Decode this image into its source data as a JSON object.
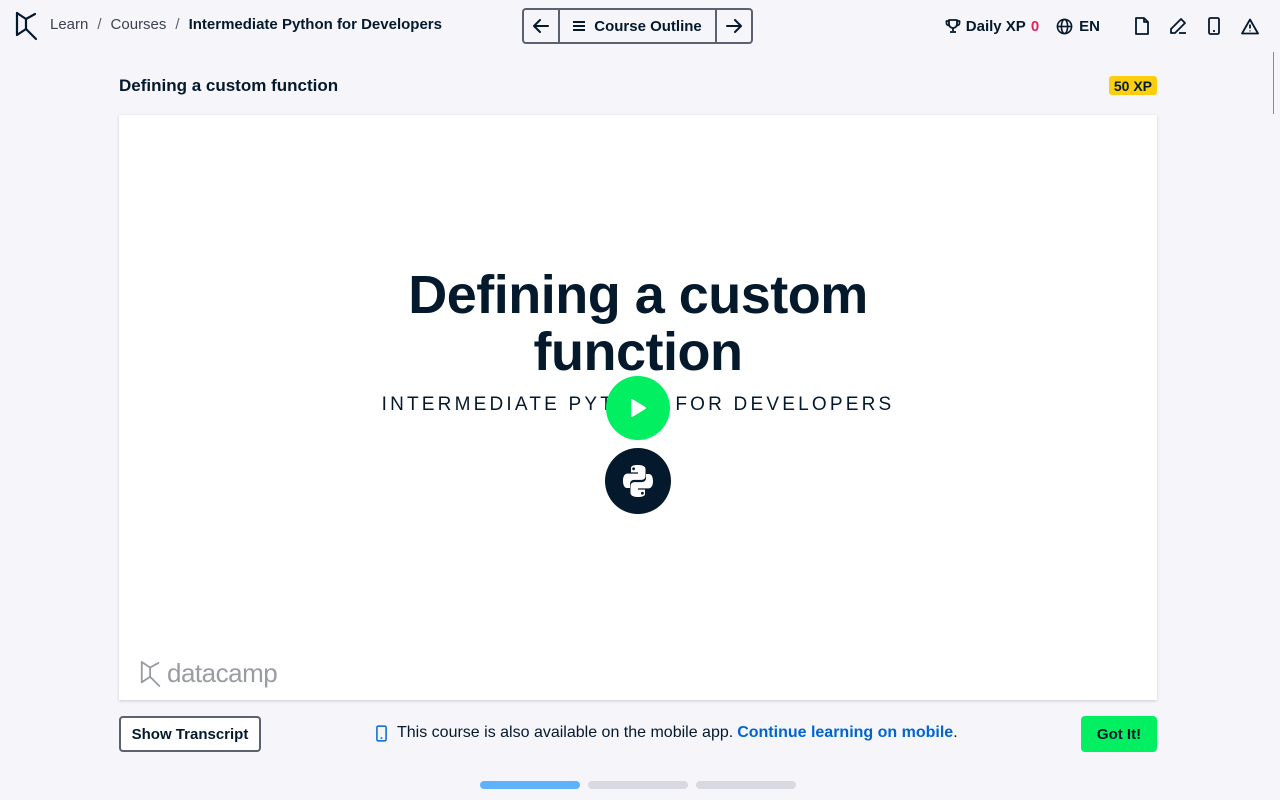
{
  "header": {
    "breadcrumb": [
      "Learn",
      "Courses"
    ],
    "breadcrumb_current": "Intermediate Python for Developers",
    "outline_label": "Course Outline",
    "daily_xp_label": "Daily XP",
    "daily_xp_value": "0",
    "language": "EN",
    "icons": [
      "datacamp-logo",
      "arrow-left-icon",
      "menu-icon",
      "arrow-right-icon",
      "trophy-icon",
      "globe-icon",
      "file-icon",
      "edit-icon",
      "mobile-icon",
      "warning-icon"
    ]
  },
  "exercise": {
    "title": "Defining a custom function",
    "xp": "50 XP"
  },
  "video": {
    "slide_title_line1": "Defining a custom",
    "slide_title_line2": "function",
    "slide_subtitle": "INTERMEDIATE PYTHON FOR DEVELOPERS",
    "watermark": "datacamp"
  },
  "footer": {
    "transcript_label": "Show Transcript",
    "mobile_text": "This course is also available on the mobile app.",
    "mobile_link": "Continue learning on mobile",
    "mobile_suffix": ".",
    "got_it_label": "Got It!"
  },
  "progress": {
    "segments": 3,
    "active_index": 0
  },
  "colors": {
    "accent_green": "#03ef62",
    "navy": "#05192d",
    "link_blue": "#0065d1",
    "xp_yellow": "#fcce0d",
    "progress_blue": "#5eb1ff"
  }
}
